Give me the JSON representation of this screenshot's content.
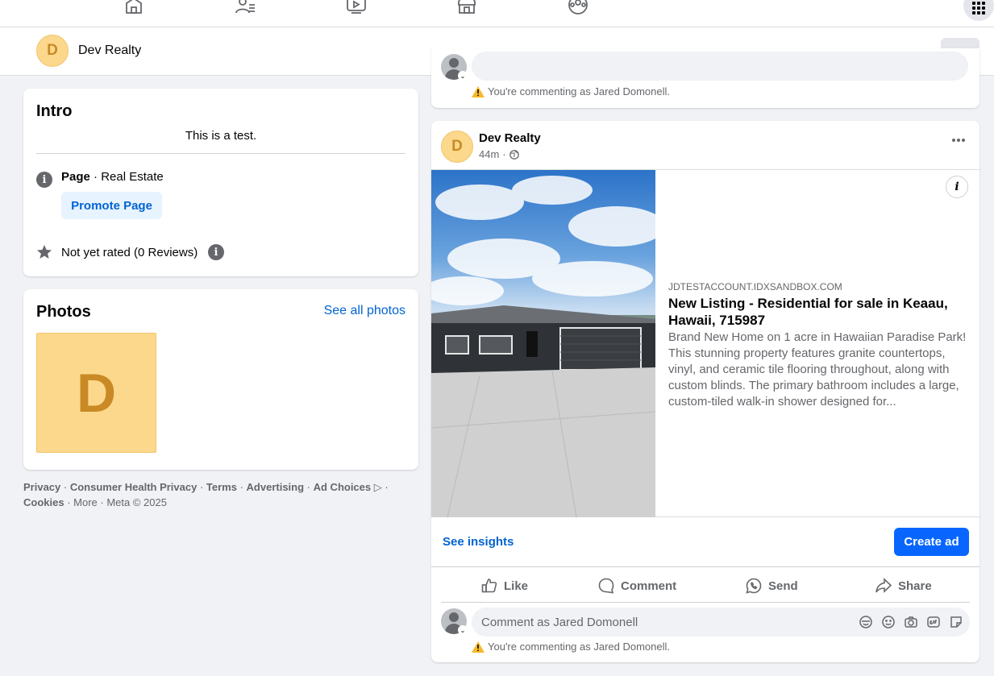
{
  "nav": {
    "icons": [
      "home-icon",
      "friends-icon",
      "video-icon",
      "marketplace-icon",
      "groups-icon",
      "apps-menu-icon"
    ]
  },
  "page_header": {
    "avatar_letter": "D",
    "name": "Dev Realty"
  },
  "intro": {
    "title": "Intro",
    "bio": "This is a test.",
    "category_label": "Page",
    "category_sep": " · ",
    "category_value": "Real Estate",
    "promote_label": "Promote Page",
    "rating_text": "Not yet rated (0 Reviews)"
  },
  "photos": {
    "title": "Photos",
    "see_all": "See all photos",
    "thumb_letter": "D"
  },
  "footer": {
    "links": [
      "Privacy",
      "Consumer Health Privacy",
      "Terms",
      "Advertising",
      "Ad Choices"
    ],
    "cookies": "Cookies",
    "more": "More",
    "meta": "Meta © 2025",
    "sep": " · "
  },
  "prev_post": {
    "warning": "You're commenting as Jared Domonell."
  },
  "post": {
    "author": "Dev Realty",
    "avatar_letter": "D",
    "time": "44m",
    "time_sep": " · ",
    "link": {
      "domain": "JDTESTACCOUNT.IDXSANDBOX.COM",
      "title": "New Listing - Residential for sale in Keaau, Hawaii, 715987",
      "description": "Brand New Home on 1 acre in Hawaiian Paradise Park! This stunning property features granite countertops, vinyl, and ceramic tile flooring throughout, along with custom blinds. The primary bathroom includes a large, custom-tiled walk-in shower designed for..."
    },
    "see_insights": "See insights",
    "create_ad": "Create ad",
    "actions": {
      "like": "Like",
      "comment": "Comment",
      "send": "Send",
      "share": "Share"
    },
    "comment_placeholder": "Comment as Jared Domonell",
    "warning": "You're commenting as Jared Domonell."
  },
  "colors": {
    "accent": "#0866ff",
    "link": "#0064d1",
    "avatar_bg": "#fcd88c",
    "avatar_fg": "#c98a25",
    "warning": "#f7b928"
  }
}
